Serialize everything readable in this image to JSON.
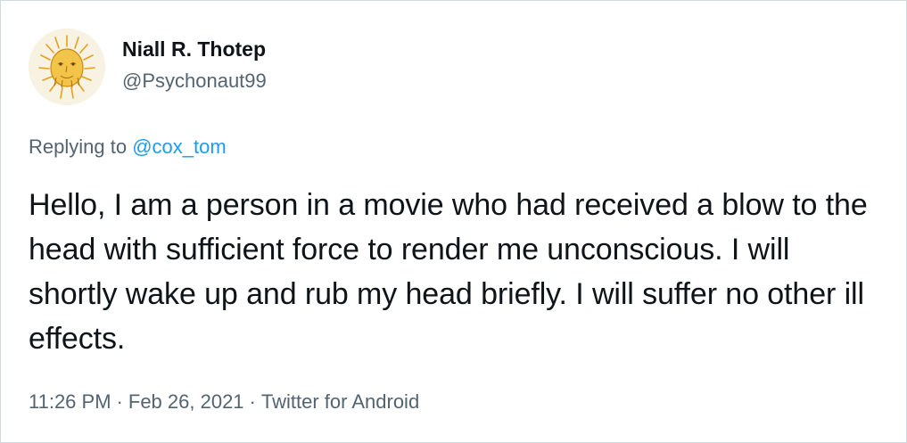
{
  "author": {
    "display_name": "Niall R. Thotep",
    "handle": "@Psychonaut99",
    "avatar_icon": "bearded-sketch-portrait-icon"
  },
  "reply": {
    "prefix": "Replying to",
    "to_handle": "@cox_tom"
  },
  "tweet": {
    "text": "Hello, I am a person in a movie who had received a blow to the head with sufficient force to render me unconscious. I will shortly wake up and rub my head briefly. I will suffer no other ill effects."
  },
  "meta": {
    "time": "11:26 PM",
    "separator": "·",
    "date": "Feb 26, 2021",
    "source": "Twitter for Android"
  },
  "colors": {
    "text_primary": "#0f1419",
    "text_secondary": "#536471",
    "link": "#1d9bf0",
    "border": "#cfd9de"
  }
}
